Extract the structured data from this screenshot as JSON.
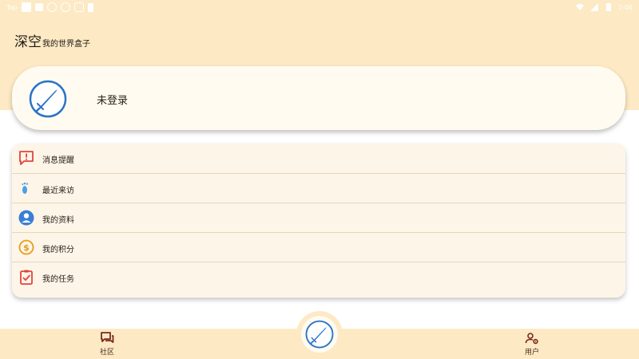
{
  "status_bar": {
    "carrier": "Tap",
    "time": "2:06"
  },
  "header": {
    "title_main": "深空",
    "title_sub": "我的世界盒子"
  },
  "user_card": {
    "login_status": "未登录",
    "logo_icon": "sword-logo-icon"
  },
  "menu": {
    "items": [
      {
        "label": "消息提醒",
        "icon": "message-alert-icon",
        "color": "#e0453a"
      },
      {
        "label": "最近来访",
        "icon": "footprints-icon",
        "color": "#4d9ee8"
      },
      {
        "label": "我的资料",
        "icon": "profile-icon",
        "color": "#3a7fd5"
      },
      {
        "label": "我的积分",
        "icon": "coin-icon",
        "color": "#e99a1c"
      },
      {
        "label": "我的任务",
        "icon": "task-clipboard-icon",
        "color": "#e0453a"
      }
    ]
  },
  "bottom_nav": {
    "community_label": "社区",
    "user_label": "用户"
  },
  "colors": {
    "header_bg": "#fde9c4",
    "card_bg": "#fffbf1",
    "menu_bg": "#fdf5e8",
    "nav_icon": "#7a2a1e"
  }
}
